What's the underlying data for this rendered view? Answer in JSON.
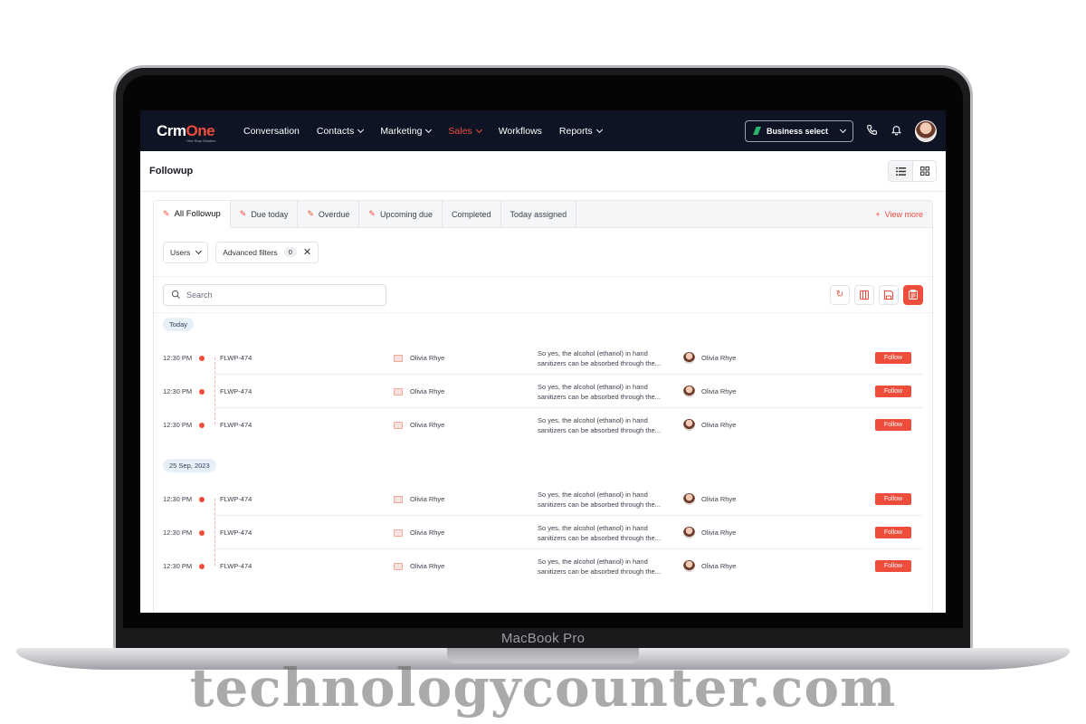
{
  "laptop": {
    "brand": "MacBook Pro"
  },
  "watermark": "technologycounter.com",
  "app": {
    "logo": {
      "main_a": "Crm",
      "main_b": "One",
      "tagline": "One Stop Solution"
    },
    "nav": [
      {
        "label": "Conversation",
        "dropdown": false
      },
      {
        "label": "Contacts",
        "dropdown": true
      },
      {
        "label": "Marketing",
        "dropdown": true
      },
      {
        "label": "Sales",
        "dropdown": true,
        "active": true
      },
      {
        "label": "Workflows",
        "dropdown": false
      },
      {
        "label": "Reports",
        "dropdown": true
      }
    ],
    "business_select": "Business select",
    "accent": "#ef4d3c",
    "nav_bg": "#0e1424"
  },
  "page": {
    "title": "Followup"
  },
  "tabs": [
    {
      "label": "All Followup",
      "icon": "pin-icon",
      "active": true
    },
    {
      "label": "Due today",
      "icon": "pin-icon"
    },
    {
      "label": "Overdue",
      "icon": "pin-icon"
    },
    {
      "label": "Upcoming due",
      "icon": "pin-icon"
    },
    {
      "label": "Completed"
    },
    {
      "label": "Today assigned"
    }
  ],
  "view_more": "View more",
  "filters": {
    "users": "Users",
    "advanced": "Advanced filters",
    "advanced_count": "0"
  },
  "search": {
    "placeholder": "Search"
  },
  "groups": [
    {
      "date": "Today",
      "rows": [
        {
          "time": "12:30 PM",
          "code": "FLWP-474",
          "owner": "Olivia Rhye",
          "desc1": "So yes, the alcohol (ethanol) in hand",
          "desc2": "sanitizers can be absorbed through the...",
          "assignee": "Olivia Rhye",
          "action": "Follow"
        },
        {
          "time": "12:30 PM",
          "code": "FLWP-474",
          "owner": "Olivia Rhye",
          "desc1": "So yes, the alcohol (ethanol) in hand",
          "desc2": "sanitizers can be absorbed through the...",
          "assignee": "Olivia Rhye",
          "action": "Follow"
        },
        {
          "time": "12:30 PM",
          "code": "FLWP-474",
          "owner": "Olivia Rhye",
          "desc1": "So yes, the alcohol (ethanol) in hand",
          "desc2": "sanitizers can be absorbed through the...",
          "assignee": "Olivia Rhye",
          "action": "Follow"
        }
      ]
    },
    {
      "date": "25 Sep, 2023",
      "rows": [
        {
          "time": "12:30 PM",
          "code": "FLWP-474",
          "owner": "Olivia Rhye",
          "desc1": "So yes, the alcohol (ethanol) in hand",
          "desc2": "sanitizers can be absorbed through the...",
          "assignee": "Olivia Rhye",
          "action": "Follow"
        },
        {
          "time": "12:30 PM",
          "code": "FLWP-474",
          "owner": "Olivia Rhye",
          "desc1": "So yes, the alcohol (ethanol) in hand",
          "desc2": "sanitizers can be absorbed through the...",
          "assignee": "Olivia Rhye",
          "action": "Follow"
        },
        {
          "time": "12:30 PM",
          "code": "FLWP-474",
          "owner": "Olivia Rhye",
          "desc1": "So yes, the alcohol (ethanol) in hand",
          "desc2": "sanitizers can be absorbed through the...",
          "assignee": "Olivia Rhye",
          "action": "Follow"
        }
      ]
    }
  ]
}
